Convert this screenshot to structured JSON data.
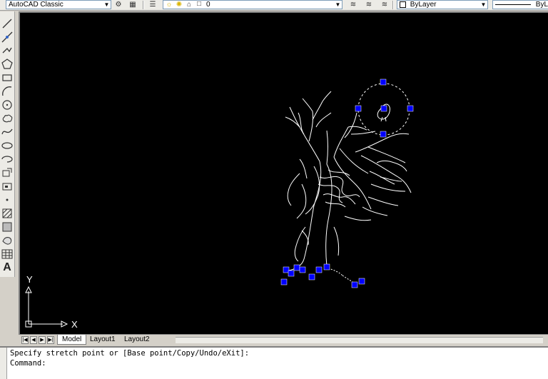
{
  "toolbar": {
    "workspace": "AutoCAD Classic",
    "layer": "0",
    "color": "ByLayer",
    "linetype": "ByL"
  },
  "tools": [
    {
      "name": "line-icon"
    },
    {
      "name": "construction-line-icon"
    },
    {
      "name": "polyline-icon"
    },
    {
      "name": "polygon-icon"
    },
    {
      "name": "rectangle-icon"
    },
    {
      "name": "arc-icon"
    },
    {
      "name": "circle-icon"
    },
    {
      "name": "revision-cloud-icon"
    },
    {
      "name": "spline-icon"
    },
    {
      "name": "ellipse-icon"
    },
    {
      "name": "ellipse-arc-icon"
    },
    {
      "name": "insert-block-icon"
    },
    {
      "name": "make-block-icon"
    },
    {
      "name": "point-icon"
    },
    {
      "name": "hatch-icon"
    },
    {
      "name": "gradient-icon"
    },
    {
      "name": "region-icon"
    },
    {
      "name": "table-icon"
    },
    {
      "name": "multiline-text-icon",
      "label": "A"
    }
  ],
  "ucs": {
    "y_label": "Y",
    "x_label": "X"
  },
  "tabs": {
    "model": "Model",
    "layout1": "Layout1",
    "layout2": "Layout2"
  },
  "command": {
    "history": "Specify stretch point or [Base point/Copy/Undo/eXit]:",
    "prompt": "Command:"
  },
  "colors": {
    "canvas": "#000000",
    "grip": "#0000ff",
    "linework": "#ffffff"
  }
}
